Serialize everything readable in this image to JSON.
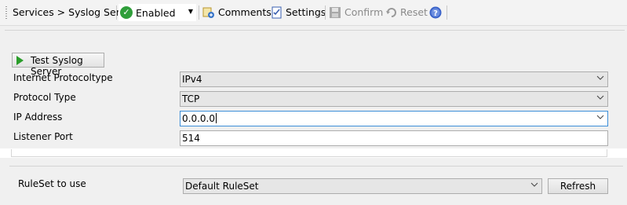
{
  "toolbar": {
    "breadcrumb": "Services > Syslog Server",
    "state_value": "Enabled",
    "comments_label": "Comments",
    "settings_label": "Settings",
    "confirm_label": "Confirm",
    "reset_label": "Reset"
  },
  "main": {
    "test_button_label": "Test Syslog Server",
    "internet_protocol_label": "Internet Protocoltype",
    "internet_protocol_value": "IPv4",
    "protocol_type_label": "Protocol Type",
    "protocol_type_value": "TCP",
    "ip_address_label": "IP Address",
    "ip_address_value": "0.0.0.0",
    "listener_port_label": "Listener Port",
    "listener_port_value": "514"
  },
  "ruleset": {
    "label": "RuleSet to use",
    "value": "Default RuleSet",
    "refresh_label": "Refresh"
  },
  "colors": {
    "enabled_green": "#2f9e3a",
    "focus_border": "#3c8ed8",
    "help_blue": "#3b63c9"
  }
}
